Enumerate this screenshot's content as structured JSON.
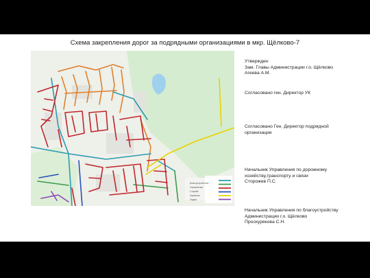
{
  "page": {
    "title": "Схема закрепления дорог за подрядными организациями в мкр. Щёлково-7"
  },
  "map": {
    "legend_colors": [
      "#e0802a",
      "#2a9bb0",
      "#2a4fb8",
      "#3b9a4a",
      "#c0242b",
      "#8a44b8",
      "#e8d200"
    ],
    "legend_labels": [
      "Благоустройство",
      "Управление",
      "Служба",
      "Заказчик",
      "Отдел"
    ]
  },
  "approvals": [
    {
      "lines": [
        "Утвержден",
        "Зам. Главы Администрации г.о. Щёлково",
        "Агеева А.М."
      ]
    },
    {
      "lines": [
        "Согласовано ген. Директор УК"
      ]
    },
    {
      "lines": [
        "Согласовано Ген. Директор подрядной",
        "организации"
      ]
    },
    {
      "lines": [
        "Начальник Управления по дорожному",
        "хозяйству,транспорту и связи",
        "Сторожев П.С."
      ]
    },
    {
      "lines": [
        "Начальник Управления по благоустройству",
        "Администрации г.о. Щёлково",
        "Проскурякова С.Н."
      ]
    }
  ]
}
